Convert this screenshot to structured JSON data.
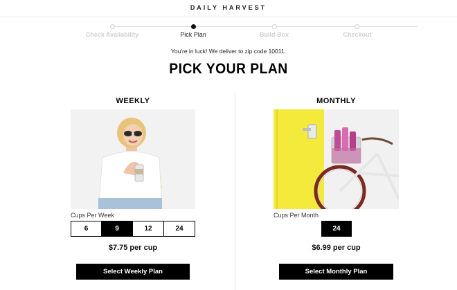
{
  "brand": "DAILY HARVEST",
  "steps": [
    {
      "label": "Check Availability",
      "active": false
    },
    {
      "label": "Pick Plan",
      "active": true
    },
    {
      "label": "Build Box",
      "active": false
    },
    {
      "label": "Checkout",
      "active": false
    }
  ],
  "notice": "You're in luck! We deliver to zip code 10011.",
  "heading": "PICK YOUR PLAN",
  "weekly": {
    "title": "WEEKLY",
    "cups_label": "Cups Per Week",
    "options": [
      "6",
      "9",
      "12",
      "24"
    ],
    "selected": "9",
    "price": "$7.75 per cup",
    "cta": "Select Weekly Plan"
  },
  "monthly": {
    "title": "MONTHLY",
    "cups_label": "Cups Per Month",
    "options": [
      "24"
    ],
    "selected": "24",
    "price": "$6.99 per cup",
    "cta": "Select Monthly Plan"
  },
  "colors": {
    "accent": "#000000",
    "yellow_wall": "#f3ea3c",
    "pink_cups": "#c04a96"
  }
}
